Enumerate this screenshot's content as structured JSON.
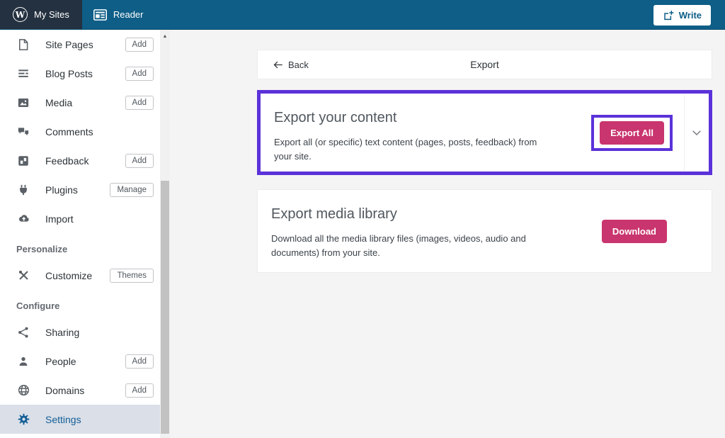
{
  "topbar": {
    "my_sites_label": "My Sites",
    "reader_label": "Reader",
    "write_label": "Write"
  },
  "sidebar": {
    "items": [
      {
        "label": "Site Pages",
        "badge": "Add"
      },
      {
        "label": "Blog Posts",
        "badge": "Add"
      },
      {
        "label": "Media",
        "badge": "Add"
      },
      {
        "label": "Comments"
      },
      {
        "label": "Feedback",
        "badge": "Add"
      },
      {
        "label": "Plugins",
        "badge": "Manage"
      },
      {
        "label": "Import"
      },
      {
        "label": "Customize",
        "badge": "Themes"
      },
      {
        "label": "Sharing"
      },
      {
        "label": "People",
        "badge": "Add"
      },
      {
        "label": "Domains",
        "badge": "Add"
      },
      {
        "label": "Settings"
      }
    ],
    "section_personalize": "Personalize",
    "section_configure": "Configure"
  },
  "main": {
    "back_label": "Back",
    "page_title": "Export",
    "cards": [
      {
        "title": "Export your content",
        "description": "Export all (or specific) text content (pages, posts, feedback) from your site.",
        "button_label": "Export All"
      },
      {
        "title": "Export media library",
        "description": "Download all the media library files (images, videos, audio and documents) from your site.",
        "button_label": "Download"
      }
    ]
  },
  "colors": {
    "topbar_blue": "#0e5e87",
    "topbar_dark": "#243140",
    "accent_pink": "#c9356e",
    "annotation_purple": "#5b32d9",
    "active_item_blue": "#135e96",
    "active_item_bg": "#dadfe8"
  }
}
